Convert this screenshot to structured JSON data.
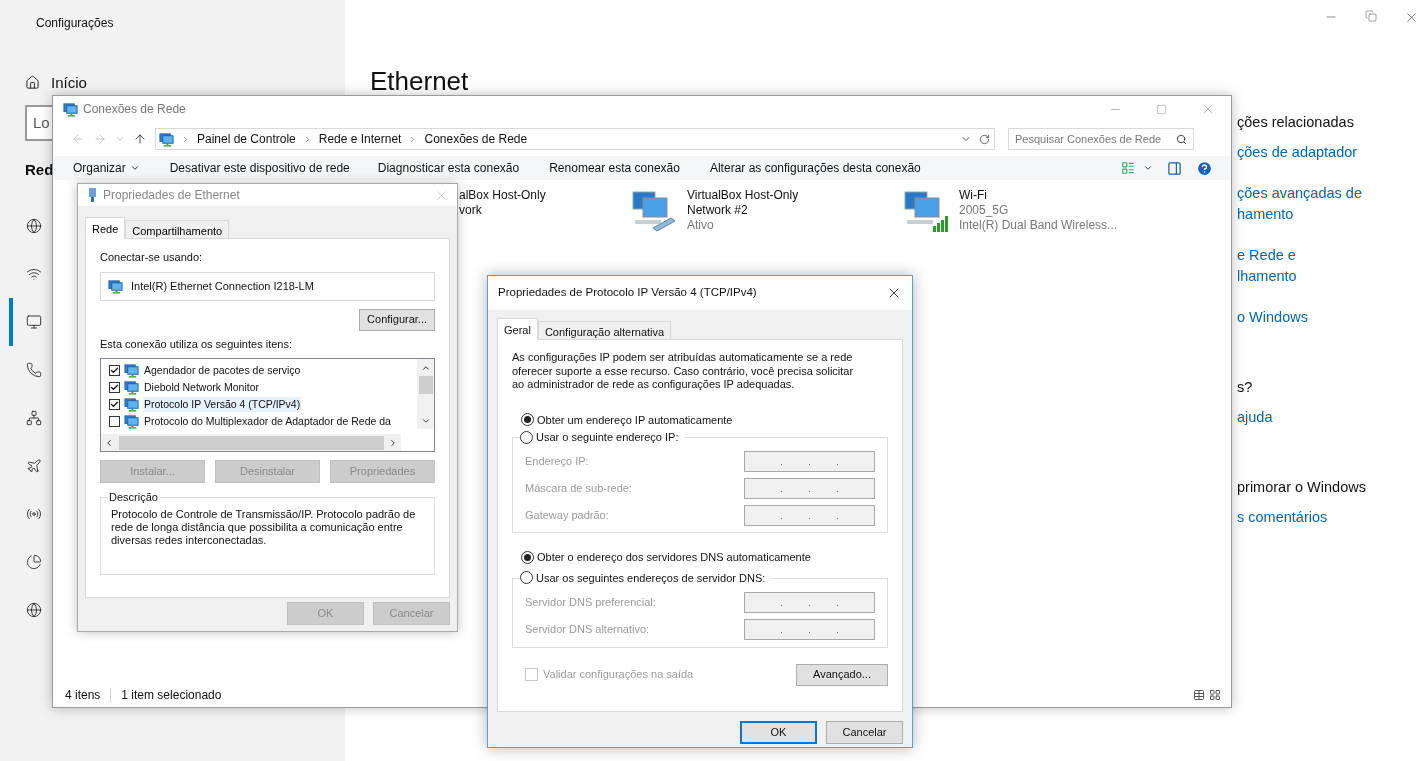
{
  "settings": {
    "title": "Configurações",
    "home": "Início",
    "search_value": "Lo",
    "section": "Red",
    "heading": "Ethernet",
    "nav": [
      {
        "selected": false
      },
      {
        "selected": false
      },
      {
        "selected": true
      },
      {
        "selected": false
      },
      {
        "selected": false
      },
      {
        "selected": false
      },
      {
        "selected": false
      },
      {
        "selected": false
      },
      {
        "selected": false
      }
    ],
    "related": [
      {
        "kind": "heading",
        "lines": [
          "ções relacionadas"
        ]
      },
      {
        "kind": "link",
        "lines": [
          "ções de adaptador"
        ]
      },
      {
        "kind": "link",
        "lines": [
          "ções avançadas de",
          "hamento"
        ]
      },
      {
        "kind": "link",
        "lines": [
          "e Rede e",
          "lhamento"
        ]
      },
      {
        "kind": "link",
        "lines": [
          "o Windows"
        ]
      },
      {
        "kind": "heading",
        "lines": [
          "s?"
        ]
      },
      {
        "kind": "link",
        "lines": [
          "ajuda"
        ]
      },
      {
        "kind": "heading",
        "lines": [
          "primorar o Windows"
        ]
      },
      {
        "kind": "link",
        "lines": [
          "s comentários"
        ]
      }
    ]
  },
  "connections": {
    "title": "Conexões de Rede",
    "breadcrumb": [
      "Painel de Controle",
      "Rede e Internet",
      "Conexões de Rede"
    ],
    "search": {
      "placeholder": "Pesquisar Conexões de Rede"
    },
    "toolbar": [
      "Organizar",
      "Desativar este dispositivo de rede",
      "Diagnosticar esta conexão",
      "Renomear esta conexão",
      "Alterar as configurações desta conexão"
    ],
    "items": [
      {
        "name_lines": [
          "alBox Host-Only",
          "vork"
        ]
      },
      {
        "kind": "wired",
        "name_lines": [
          "VirtualBox Host-Only",
          "Network #2"
        ],
        "status": "Ativo"
      },
      {
        "kind": "wireless",
        "name_lines": [
          "Wi-Fi"
        ],
        "status": "2005_5G",
        "device": "Intel(R) Dual Band Wireless..."
      }
    ],
    "status_bar": {
      "count": "4 itens",
      "selection": "1 item selecionado"
    }
  },
  "ethernet_properties": {
    "title": "Propriedades de Ethernet",
    "tabs": [
      {
        "label": "Rede",
        "selected": true
      },
      {
        "label": "Compartilhamento",
        "selected": false
      }
    ],
    "connect_label": "Conectar-se usando:",
    "adapter": "Intel(R) Ethernet Connection I218-LM",
    "configure_button": "Configurar...",
    "items_label": "Esta conexão utiliza os seguintes itens:",
    "items": [
      {
        "label": "Agendador de pacotes de serviço",
        "checked": true,
        "selected": false
      },
      {
        "label": "Diebold Network Monitor",
        "checked": true,
        "selected": false
      },
      {
        "label": "Protocolo IP Versão 4 (TCP/IPv4)",
        "checked": true,
        "selected": true
      },
      {
        "label": "Protocolo do Multiplexador de Adaptador de Rede da",
        "checked": false,
        "selected": false
      }
    ],
    "buttons": [
      {
        "label": "Instalar...",
        "disabled": true
      },
      {
        "label": "Desinstalar",
        "disabled": true
      },
      {
        "label": "Propriedades",
        "disabled": true
      }
    ],
    "description_title": "Descrição",
    "description": "Protocolo de Controle de Transmissão/IP. Protocolo padrão de rede de longa distância que possibilita a comunicação entre diversas redes interconectadas.",
    "footer": [
      {
        "label": "OK",
        "disabled": true
      },
      {
        "label": "Cancelar",
        "disabled": true
      }
    ]
  },
  "ipv4_properties": {
    "title": "Propriedades de Protocolo IP Versão 4 (TCP/IPv4)",
    "tabs": [
      {
        "label": "Geral",
        "selected": true
      },
      {
        "label": "Configuração alternativa",
        "selected": false
      }
    ],
    "intro": "As configurações IP podem ser atribuídas automaticamente se a rede oferecer suporte a esse recurso. Caso contrário, você precisa solicitar ao administrador de rede as configurações IP adequadas.",
    "ip_options": [
      {
        "label": "Obter um endereço IP automaticamente",
        "selected": true
      },
      {
        "label": "Usar o seguinte endereço IP:",
        "selected": false
      }
    ],
    "ip_fields": [
      {
        "label": "Endereço IP:",
        "disabled": true
      },
      {
        "label": "Máscara de sub-rede:",
        "disabled": true
      },
      {
        "label": "Gateway padrão:",
        "disabled": true
      }
    ],
    "dns_options": [
      {
        "label": "Obter o endereço dos servidores DNS automaticamente",
        "selected": true
      },
      {
        "label": "Usar os seguintes endereços de servidor DNS:",
        "selected": false
      }
    ],
    "dns_fields": [
      {
        "label": "Servidor DNS preferencial:",
        "disabled": true
      },
      {
        "label": "Servidor DNS alternativo:",
        "disabled": true
      }
    ],
    "validate": {
      "label": "Validar configurações na saída",
      "checked": false,
      "disabled": true
    },
    "advanced_button": "Avançado...",
    "footer": [
      {
        "label": "OK",
        "default": true
      },
      {
        "label": "Cancelar",
        "default": false
      }
    ]
  }
}
